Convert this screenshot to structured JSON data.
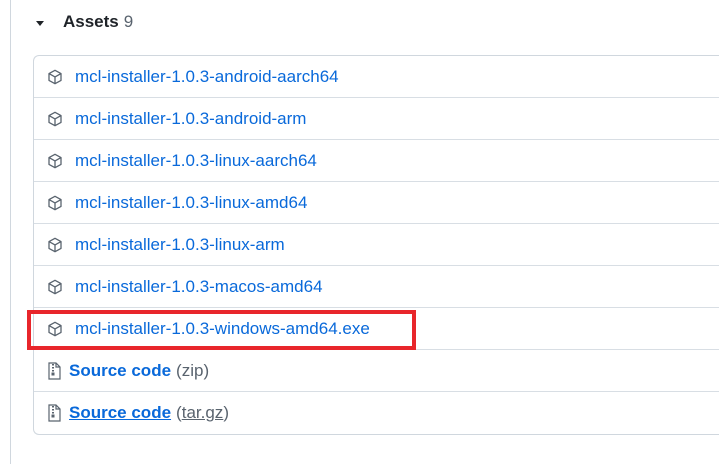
{
  "assets": {
    "title": "Assets",
    "count": "9",
    "packages": [
      {
        "name": "mcl-installer-1.0.3-android-aarch64"
      },
      {
        "name": "mcl-installer-1.0.3-android-arm"
      },
      {
        "name": "mcl-installer-1.0.3-linux-aarch64"
      },
      {
        "name": "mcl-installer-1.0.3-linux-amd64"
      },
      {
        "name": "mcl-installer-1.0.3-linux-arm"
      },
      {
        "name": "mcl-installer-1.0.3-macos-amd64"
      },
      {
        "name": "mcl-installer-1.0.3-windows-amd64.exe"
      }
    ],
    "source_zip": {
      "label": "Source code",
      "open": "(",
      "ext": "zip",
      "close": ")"
    },
    "source_targz": {
      "label": "Source code",
      "open": "(",
      "ext": "tar.gz",
      "close": ")"
    }
  },
  "colors": {
    "link": "#0969da",
    "muted": "#59636e",
    "border": "#d0d7de",
    "highlight": "#e8262b"
  },
  "icons": {
    "package": "package-icon",
    "zip": "file-zip-icon",
    "caret": "triangle-down-icon"
  }
}
